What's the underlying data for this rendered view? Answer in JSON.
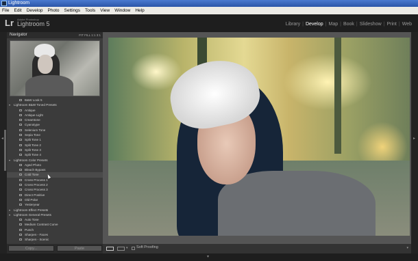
{
  "window": {
    "title": "Lightroom"
  },
  "menu": [
    "File",
    "Edit",
    "Develop",
    "Photo",
    "Settings",
    "Tools",
    "View",
    "Window",
    "Help"
  ],
  "identity": {
    "logo": "Lr",
    "company": "Adobe Photoshop",
    "product": "Lightroom 5"
  },
  "modules": [
    {
      "label": "Library",
      "active": false
    },
    {
      "label": "Develop",
      "active": true
    },
    {
      "label": "Map",
      "active": false
    },
    {
      "label": "Book",
      "active": false
    },
    {
      "label": "Slideshow",
      "active": false
    },
    {
      "label": "Print",
      "active": false
    },
    {
      "label": "Web",
      "active": false
    }
  ],
  "navigator": {
    "title": "Navigator",
    "zoom_options": "FIT  FILL  1:1  3:1"
  },
  "presets": [
    {
      "type": "item",
      "label": "B&W Look 5"
    },
    {
      "type": "folder",
      "label": "Lightroom B&W Toned Presets"
    },
    {
      "type": "item",
      "label": "Antique"
    },
    {
      "type": "item",
      "label": "Antique Light"
    },
    {
      "type": "item",
      "label": "Creamtone"
    },
    {
      "type": "item",
      "label": "Cyanotype"
    },
    {
      "type": "item",
      "label": "Selenium Tone"
    },
    {
      "type": "item",
      "label": "Sepia Tone"
    },
    {
      "type": "item",
      "label": "Split Tone 1"
    },
    {
      "type": "item",
      "label": "Split Tone 2"
    },
    {
      "type": "item",
      "label": "Split Tone 3"
    },
    {
      "type": "item",
      "label": "Split Tone 4"
    },
    {
      "type": "folder",
      "label": "Lightroom Color Presets"
    },
    {
      "type": "item",
      "label": "Aged Photo"
    },
    {
      "type": "item",
      "label": "Bleach Bypass"
    },
    {
      "type": "item",
      "label": "Cold Tone",
      "selected": true
    },
    {
      "type": "item",
      "label": "Cross Process 1"
    },
    {
      "type": "item",
      "label": "Cross Process 2"
    },
    {
      "type": "item",
      "label": "Cross Process 3"
    },
    {
      "type": "item",
      "label": "Direct Positive"
    },
    {
      "type": "item",
      "label": "Old Polar"
    },
    {
      "type": "item",
      "label": "Yesteryear"
    },
    {
      "type": "folder",
      "label": "Lightroom Effect Presets"
    },
    {
      "type": "folder",
      "label": "Lightroom General Presets"
    },
    {
      "type": "item",
      "label": "Auto Tone"
    },
    {
      "type": "item",
      "label": "Medium Contrast Curve"
    },
    {
      "type": "item",
      "label": "Punch"
    },
    {
      "type": "item",
      "label": "Sharpen - Faces"
    },
    {
      "type": "item",
      "label": "Sharpen - Scenic"
    },
    {
      "type": "item",
      "label": "Zeroed"
    }
  ],
  "buttons": {
    "copy": "Copy...",
    "paste": "Paste"
  },
  "toolbar": {
    "soft_proofing": "Soft Proofing",
    "end_arrow": "▾"
  }
}
